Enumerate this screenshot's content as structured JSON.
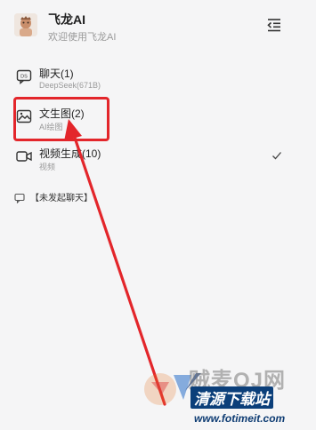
{
  "header": {
    "title": "飞龙AI",
    "subtitle": "欢迎使用飞龙AI"
  },
  "menu": {
    "items": [
      {
        "title": "聊天(1)",
        "subtitle": "DeepSeek(671B)",
        "icon": "chat-bubble-icon"
      },
      {
        "title": "文生图(2)",
        "subtitle": "AI绘图",
        "icon": "image-icon"
      },
      {
        "title": "视频生成(10)",
        "subtitle": "视频",
        "icon": "video-camera-icon",
        "selected": true
      }
    ],
    "new_chat_label": "【未发起聊天】"
  },
  "annotation": {
    "color": "#e3262b"
  },
  "watermark": {
    "top_text": "贼麦OJ网",
    "brand_text": "清源下载站",
    "url_text": "www.fotimeit.com"
  }
}
